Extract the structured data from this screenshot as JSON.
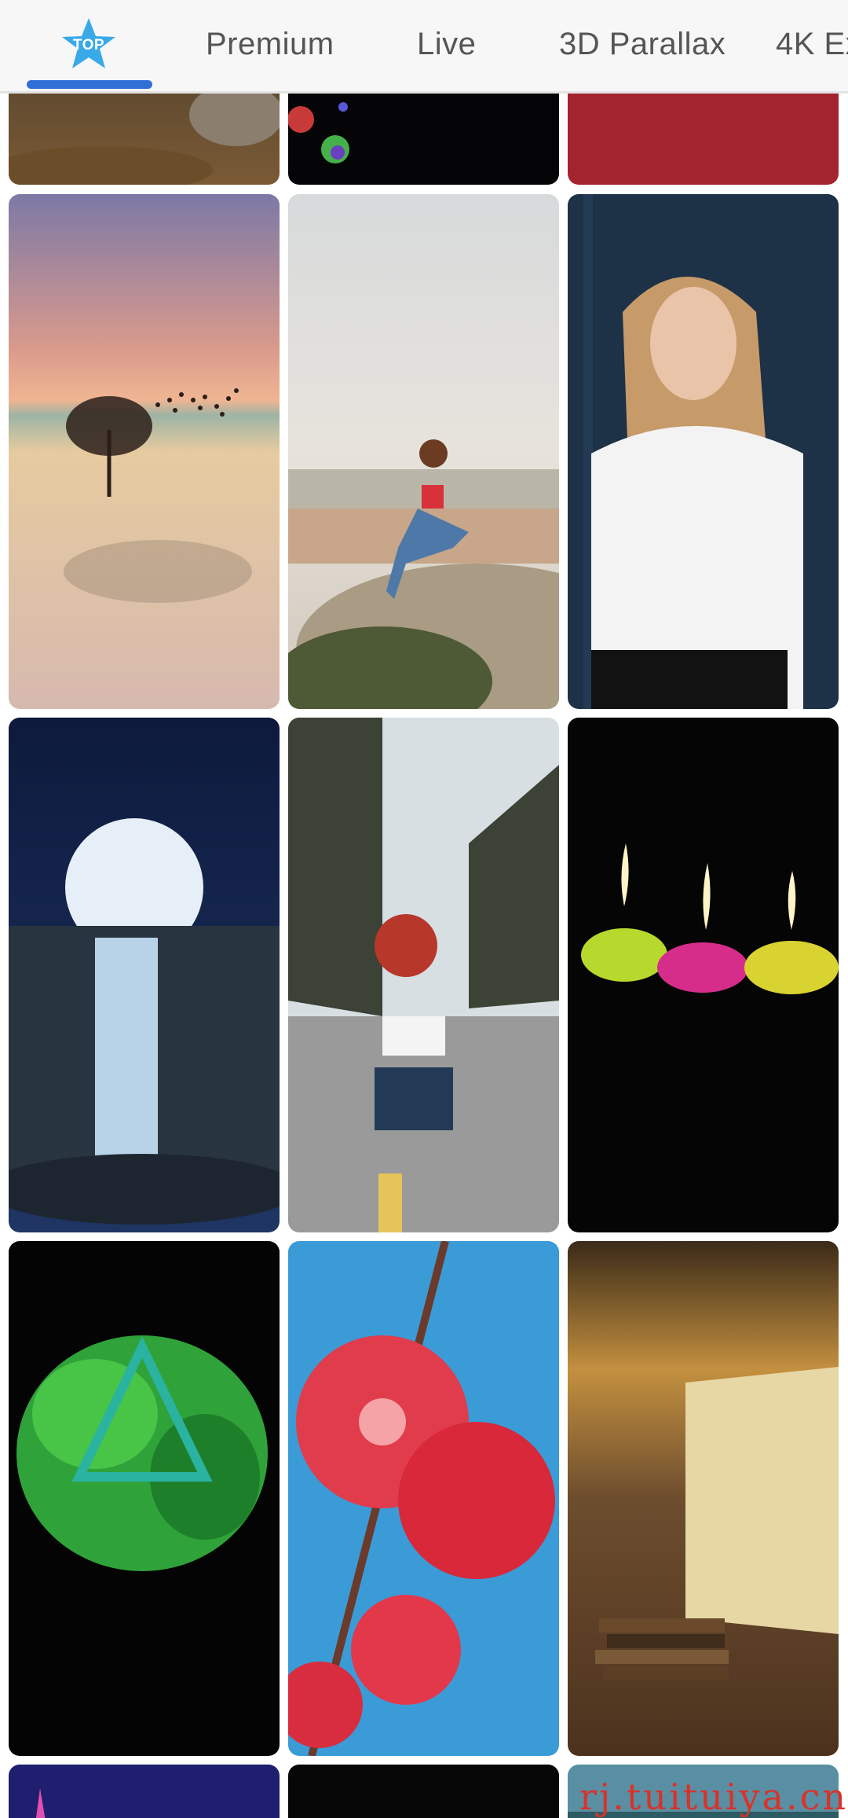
{
  "tabs": [
    {
      "label": "TOP",
      "icon": "star-top-icon",
      "active": true
    },
    {
      "label": "Premium",
      "active": false
    },
    {
      "label": "Live",
      "active": false
    },
    {
      "label": "3D Parallax",
      "active": false
    },
    {
      "label": "4K Ex",
      "active": false
    }
  ],
  "colors": {
    "accent": "#2f6fd6",
    "tab_text": "#555555",
    "watermark": "#d9322a"
  },
  "watermark": "rj.tuituiya.cn"
}
